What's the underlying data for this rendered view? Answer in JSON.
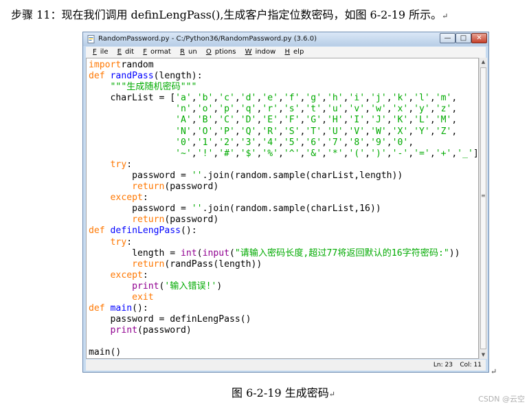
{
  "heading": {
    "text": "步骤 11：现在我们调用 definLengPass(),生成客户指定位数密码，如图 6-2-19 所示。",
    "mark": "↵"
  },
  "window": {
    "title": "RandomPassword.py - C:/Python36/RandomPassword.py (3.6.0)",
    "app_icon": "python-file-icon",
    "buttons": {
      "minimize": "—",
      "maximize": "□",
      "close": "✕"
    }
  },
  "menu": [
    {
      "key": "F",
      "rest": "ile"
    },
    {
      "key": "E",
      "rest": "dit"
    },
    {
      "key": "F",
      "rest": "ormat"
    },
    {
      "key": "R",
      "rest": "un"
    },
    {
      "key": "O",
      "rest": "ptions"
    },
    {
      "key": "W",
      "rest": "indow"
    },
    {
      "key": "H",
      "rest": "elp"
    }
  ],
  "code_lines": [
    [
      [
        "kw",
        "import"
      ],
      [
        "",
        "random"
      ]
    ],
    [
      [
        "kw",
        "def "
      ],
      [
        "def",
        "randPass"
      ],
      [
        "",
        "(length):"
      ]
    ],
    [
      [
        "",
        "    "
      ],
      [
        "str",
        "\"\"\"生成随机密码\"\"\""
      ]
    ],
    [
      [
        "",
        "    charList = ["
      ],
      [
        "str",
        "'a'"
      ],
      [
        "",
        ","
      ],
      [
        "str",
        "'b'"
      ],
      [
        "",
        ","
      ],
      [
        "str",
        "'c'"
      ],
      [
        "",
        ","
      ],
      [
        "str",
        "'d'"
      ],
      [
        "",
        ","
      ],
      [
        "str",
        "'e'"
      ],
      [
        "",
        ","
      ],
      [
        "str",
        "'f'"
      ],
      [
        "",
        ","
      ],
      [
        "str",
        "'g'"
      ],
      [
        "",
        ","
      ],
      [
        "str",
        "'h'"
      ],
      [
        "",
        ","
      ],
      [
        "str",
        "'i'"
      ],
      [
        "",
        ","
      ],
      [
        "str",
        "'j'"
      ],
      [
        "",
        ","
      ],
      [
        "str",
        "'k'"
      ],
      [
        "",
        ","
      ],
      [
        "str",
        "'l'"
      ],
      [
        "",
        ","
      ],
      [
        "str",
        "'m'"
      ],
      [
        "",
        ","
      ]
    ],
    [
      [
        "",
        "                "
      ],
      [
        "str",
        "'n'"
      ],
      [
        "",
        ","
      ],
      [
        "str",
        "'o'"
      ],
      [
        "",
        ","
      ],
      [
        "str",
        "'p'"
      ],
      [
        "",
        ","
      ],
      [
        "str",
        "'q'"
      ],
      [
        "",
        ","
      ],
      [
        "str",
        "'r'"
      ],
      [
        "",
        ","
      ],
      [
        "str",
        "'s'"
      ],
      [
        "",
        ","
      ],
      [
        "str",
        "'t'"
      ],
      [
        "",
        ","
      ],
      [
        "str",
        "'u'"
      ],
      [
        "",
        ","
      ],
      [
        "str",
        "'v'"
      ],
      [
        "",
        ","
      ],
      [
        "str",
        "'w'"
      ],
      [
        "",
        ","
      ],
      [
        "str",
        "'x'"
      ],
      [
        "",
        ","
      ],
      [
        "str",
        "'y'"
      ],
      [
        "",
        ","
      ],
      [
        "str",
        "'z'"
      ],
      [
        "",
        ","
      ]
    ],
    [
      [
        "",
        "                "
      ],
      [
        "str",
        "'A'"
      ],
      [
        "",
        ","
      ],
      [
        "str",
        "'B'"
      ],
      [
        "",
        ","
      ],
      [
        "str",
        "'C'"
      ],
      [
        "",
        ","
      ],
      [
        "str",
        "'D'"
      ],
      [
        "",
        ","
      ],
      [
        "str",
        "'E'"
      ],
      [
        "",
        ","
      ],
      [
        "str",
        "'F'"
      ],
      [
        "",
        ","
      ],
      [
        "str",
        "'G'"
      ],
      [
        "",
        ","
      ],
      [
        "str",
        "'H'"
      ],
      [
        "",
        ","
      ],
      [
        "str",
        "'I'"
      ],
      [
        "",
        ","
      ],
      [
        "str",
        "'J'"
      ],
      [
        "",
        ","
      ],
      [
        "str",
        "'K'"
      ],
      [
        "",
        ","
      ],
      [
        "str",
        "'L'"
      ],
      [
        "",
        ","
      ],
      [
        "str",
        "'M'"
      ],
      [
        "",
        ","
      ]
    ],
    [
      [
        "",
        "                "
      ],
      [
        "str",
        "'N'"
      ],
      [
        "",
        ","
      ],
      [
        "str",
        "'O'"
      ],
      [
        "",
        ","
      ],
      [
        "str",
        "'P'"
      ],
      [
        "",
        ","
      ],
      [
        "str",
        "'Q'"
      ],
      [
        "",
        ","
      ],
      [
        "str",
        "'R'"
      ],
      [
        "",
        ","
      ],
      [
        "str",
        "'S'"
      ],
      [
        "",
        ","
      ],
      [
        "str",
        "'T'"
      ],
      [
        "",
        ","
      ],
      [
        "str",
        "'U'"
      ],
      [
        "",
        ","
      ],
      [
        "str",
        "'V'"
      ],
      [
        "",
        ","
      ],
      [
        "str",
        "'W'"
      ],
      [
        "",
        ","
      ],
      [
        "str",
        "'X'"
      ],
      [
        "",
        ","
      ],
      [
        "str",
        "'Y'"
      ],
      [
        "",
        ","
      ],
      [
        "str",
        "'Z'"
      ],
      [
        "",
        ","
      ]
    ],
    [
      [
        "",
        "                "
      ],
      [
        "str",
        "'0'"
      ],
      [
        "",
        ","
      ],
      [
        "str",
        "'1'"
      ],
      [
        "",
        ","
      ],
      [
        "str",
        "'2'"
      ],
      [
        "",
        ","
      ],
      [
        "str",
        "'3'"
      ],
      [
        "",
        ","
      ],
      [
        "str",
        "'4'"
      ],
      [
        "",
        ","
      ],
      [
        "str",
        "'5'"
      ],
      [
        "",
        ","
      ],
      [
        "str",
        "'6'"
      ],
      [
        "",
        ","
      ],
      [
        "str",
        "'7'"
      ],
      [
        "",
        ","
      ],
      [
        "str",
        "'8'"
      ],
      [
        "",
        ","
      ],
      [
        "str",
        "'9'"
      ],
      [
        "",
        ","
      ],
      [
        "str",
        "'0'"
      ],
      [
        "",
        ","
      ]
    ],
    [
      [
        "",
        "                "
      ],
      [
        "str",
        "'~'"
      ],
      [
        "",
        ","
      ],
      [
        "str",
        "'!'"
      ],
      [
        "",
        ","
      ],
      [
        "str",
        "'#'"
      ],
      [
        "",
        ","
      ],
      [
        "str",
        "'$'"
      ],
      [
        "",
        ","
      ],
      [
        "str",
        "'%'"
      ],
      [
        "",
        ","
      ],
      [
        "str",
        "'^'"
      ],
      [
        "",
        ","
      ],
      [
        "str",
        "'&'"
      ],
      [
        "",
        ","
      ],
      [
        "str",
        "'*'"
      ],
      [
        "",
        ","
      ],
      [
        "str",
        "'('"
      ],
      [
        "",
        ","
      ],
      [
        "str",
        "')'"
      ],
      [
        "",
        ","
      ],
      [
        "str",
        "'-'"
      ],
      [
        "",
        ","
      ],
      [
        "str",
        "'='"
      ],
      [
        "",
        ","
      ],
      [
        "str",
        "'+'"
      ],
      [
        "",
        ","
      ],
      [
        "str",
        "'_'"
      ],
      [
        "",
        "]"
      ]
    ],
    [
      [
        "",
        "    "
      ],
      [
        "kw",
        "try"
      ],
      [
        "",
        ":"
      ]
    ],
    [
      [
        "",
        "        password = "
      ],
      [
        "str",
        "''"
      ],
      [
        "",
        ".join(random.sample(charList,length))"
      ]
    ],
    [
      [
        "",
        "        "
      ],
      [
        "kw",
        "return"
      ],
      [
        "",
        "(password)"
      ]
    ],
    [
      [
        "",
        "    "
      ],
      [
        "kw",
        "except"
      ],
      [
        "",
        ":"
      ]
    ],
    [
      [
        "",
        "        password = "
      ],
      [
        "str",
        "''"
      ],
      [
        "",
        ".join(random.sample(charList,16))"
      ]
    ],
    [
      [
        "",
        "        "
      ],
      [
        "kw",
        "return"
      ],
      [
        "",
        "(password)"
      ]
    ],
    [
      [
        "kw",
        "def "
      ],
      [
        "def",
        "definLengPass"
      ],
      [
        "",
        "():"
      ]
    ],
    [
      [
        "",
        "    "
      ],
      [
        "kw",
        "try"
      ],
      [
        "",
        ":"
      ]
    ],
    [
      [
        "",
        "        length = "
      ],
      [
        "bi",
        "int"
      ],
      [
        "",
        "("
      ],
      [
        "bi",
        "input"
      ],
      [
        "",
        "("
      ],
      [
        "str",
        "\"请输入密码长度,超过77将返回默认的16字符密码:\""
      ],
      [
        "",
        "))"
      ]
    ],
    [
      [
        "",
        "        "
      ],
      [
        "kw",
        "return"
      ],
      [
        "",
        "(randPass(length))"
      ]
    ],
    [
      [
        "",
        "    "
      ],
      [
        "kw",
        "except"
      ],
      [
        "",
        ":"
      ]
    ],
    [
      [
        "",
        "        "
      ],
      [
        "bi",
        "print"
      ],
      [
        "",
        "("
      ],
      [
        "str",
        "'输入错误!'"
      ],
      [
        "",
        ")"
      ]
    ],
    [
      [
        "",
        "        "
      ],
      [
        "kw",
        "exit"
      ]
    ],
    [
      [
        "kw",
        "def "
      ],
      [
        "def",
        "main"
      ],
      [
        "",
        "():"
      ]
    ],
    [
      [
        "",
        "    password = definLengPass()"
      ]
    ],
    [
      [
        "",
        "    "
      ],
      [
        "bi",
        "print"
      ],
      [
        "",
        "(password)"
      ]
    ],
    [
      [
        "",
        ""
      ]
    ],
    [
      [
        "",
        "main()"
      ]
    ]
  ],
  "colors": {
    "keyword": "#ff7700",
    "builtin": "#900090",
    "string": "#00aa00",
    "definition": "#0000ff"
  },
  "scrollbar": {
    "up": "▲",
    "down": "▼",
    "grip": "≡"
  },
  "status": {
    "line": "Ln: 23",
    "col": "Col: 11"
  },
  "edge_mark": "↵",
  "caption": {
    "text": "图 6-2-19  生成密码",
    "mark": "↵"
  },
  "watermark": "CSDN @云空"
}
